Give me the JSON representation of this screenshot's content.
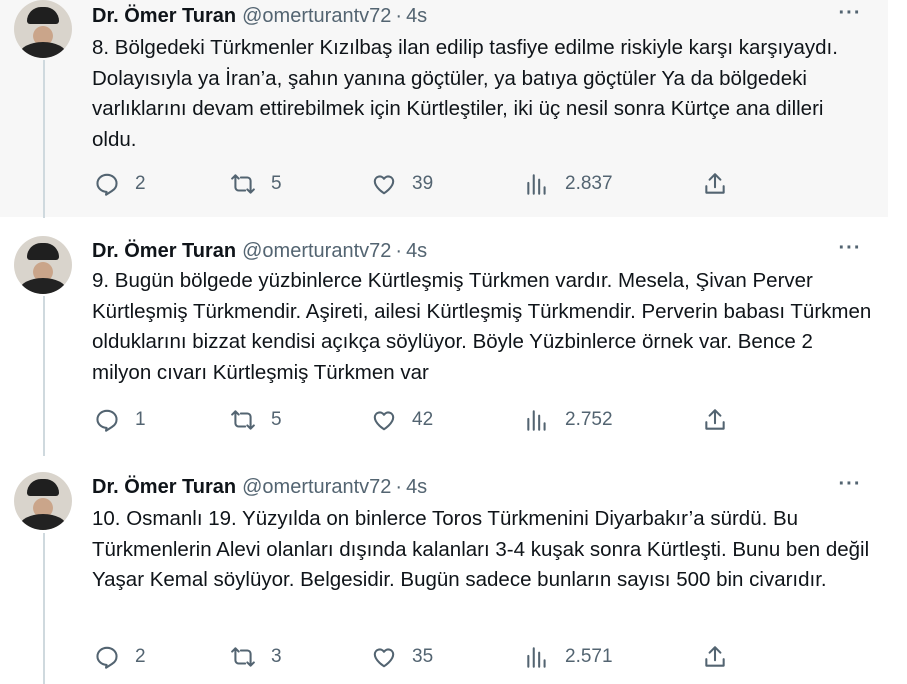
{
  "tweets": [
    {
      "author": {
        "name": "Dr. Ömer Turan",
        "handle": "@omerturantv72"
      },
      "time": "4s",
      "separator": "·",
      "text": "8. Bölgedeki Türkmenler Kızılbaş ilan edilip tasfiye edilme riskiyle karşı karşıyaydı. Dolayısıyla ya İran’a, şahın yanına göçtüler, ya batıya göçtüler Ya da bölgedeki varlıklarını devam ettirebilmek için Kürtleştiler, iki üç nesil sonra Kürtçe ana dilleri oldu.",
      "stats": {
        "replies": "2",
        "retweets": "5",
        "likes": "39",
        "views": "2.837"
      }
    },
    {
      "author": {
        "name": "Dr. Ömer Turan",
        "handle": "@omerturantv72"
      },
      "time": "4s",
      "separator": "·",
      "text": "9. Bugün bölgede yüzbinlerce Kürtleşmiş Türkmen vardır. Mesela, Şivan Perver Kürtleşmiş Türkmendir. Aşireti, ailesi Kürtleşmiş Türkmendir. Perverin babası Türkmen olduklarını bizzat kendisi açıkça söylüyor. Böyle Yüzbinlerce örnek var. Bence 2 milyon cıvarı Kürtleşmiş Türkmen var",
      "stats": {
        "replies": "1",
        "retweets": "5",
        "likes": "42",
        "views": "2.752"
      }
    },
    {
      "author": {
        "name": "Dr. Ömer Turan",
        "handle": "@omerturantv72"
      },
      "time": "4s",
      "separator": "·",
      "text": "10. Osmanlı 19. Yüzyılda on binlerce Toros Türkmenini Diyarbakır’a sürdü. Bu Türkmenlerin Alevi olanları dışında kalanları 3-4 kuşak sonra Kürtleşti. Bunu ben değil Yaşar Kemal söylüyor. Belgesidir. Bugün sadece bunların sayısı 500 bin civarıdır.",
      "stats": {
        "replies": "2",
        "retweets": "3",
        "likes": "35",
        "views": "2.571"
      }
    }
  ],
  "colors": {
    "text": "#0f1419",
    "muted": "#536471",
    "thread_line": "#cfd9de",
    "highlight_bg": "#f7f7f7"
  },
  "icons": [
    "reply-icon",
    "retweet-icon",
    "like-icon",
    "views-icon",
    "share-icon",
    "more-icon"
  ]
}
